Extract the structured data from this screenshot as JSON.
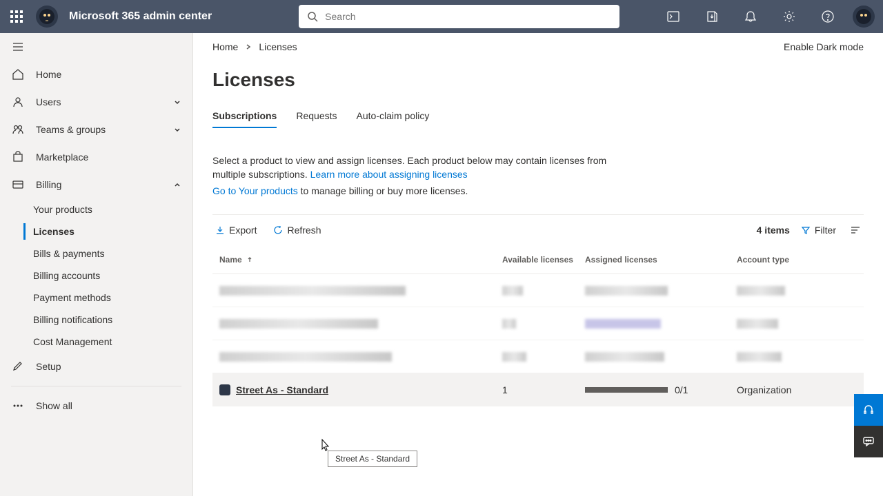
{
  "header": {
    "title": "Microsoft 365 admin center",
    "search_placeholder": "Search"
  },
  "sidebar": {
    "items": [
      {
        "label": "Home"
      },
      {
        "label": "Users"
      },
      {
        "label": "Teams & groups"
      },
      {
        "label": "Marketplace"
      },
      {
        "label": "Billing"
      },
      {
        "label": "Setup"
      }
    ],
    "billing_sub": [
      {
        "label": "Your products"
      },
      {
        "label": "Licenses"
      },
      {
        "label": "Bills & payments"
      },
      {
        "label": "Billing accounts"
      },
      {
        "label": "Payment methods"
      },
      {
        "label": "Billing notifications"
      },
      {
        "label": "Cost Management"
      }
    ],
    "show_all": "Show all"
  },
  "breadcrumb": {
    "home": "Home",
    "current": "Licenses"
  },
  "dark_mode": "Enable Dark mode",
  "page_title": "Licenses",
  "tabs": [
    {
      "label": "Subscriptions"
    },
    {
      "label": "Requests"
    },
    {
      "label": "Auto-claim policy"
    }
  ],
  "description": {
    "line1": "Select a product to view and assign licenses. Each product below may contain licenses from multiple subscriptions. ",
    "learn_more": "Learn more about assigning licenses",
    "goto": "Go to Your products",
    "line2_rest": " to manage billing or buy more licenses."
  },
  "toolbar": {
    "export": "Export",
    "refresh": "Refresh",
    "count": "4 items",
    "filter": "Filter"
  },
  "table": {
    "headers": {
      "name": "Name",
      "available": "Available licenses",
      "assigned": "Assigned licenses",
      "account": "Account type"
    },
    "row": {
      "name": " Street As - Standard",
      "available": "1",
      "assigned": "0/1",
      "account": "Organization"
    }
  },
  "tooltip": "Street As - Standard"
}
